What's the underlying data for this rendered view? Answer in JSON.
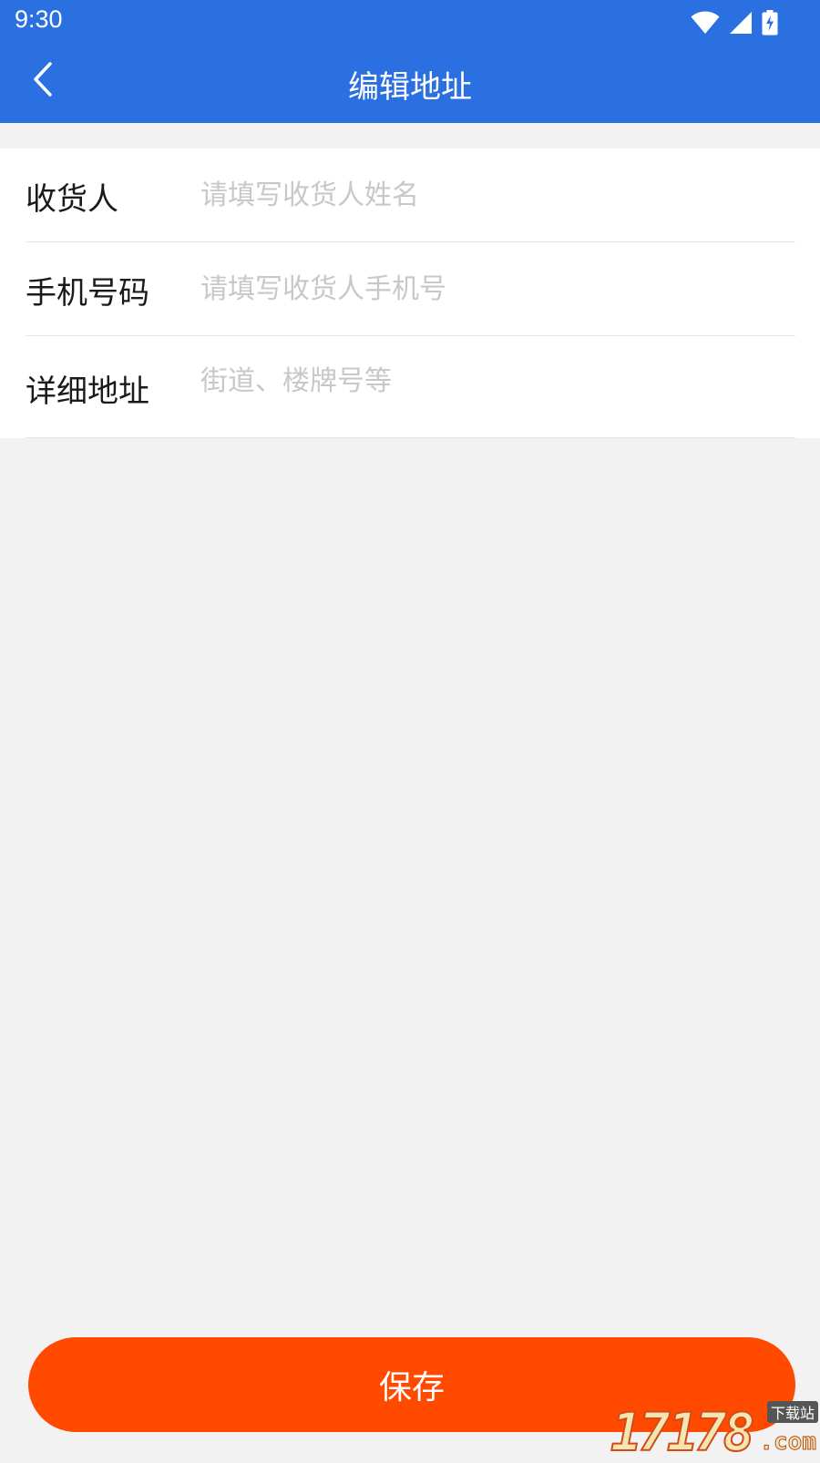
{
  "status_bar": {
    "time": "9:30",
    "icons": [
      "wifi-icon",
      "signal-icon",
      "battery-charging-icon"
    ]
  },
  "header": {
    "back_icon": "chevron-left-icon",
    "title": "编辑地址"
  },
  "form": {
    "rows": [
      {
        "label": "收货人",
        "value": "",
        "placeholder": "请填写收货人姓名"
      },
      {
        "label": "手机号码",
        "value": "",
        "placeholder": "请填写收货人手机号"
      },
      {
        "label": "详细地址",
        "value": "",
        "placeholder": "街道、楼牌号等"
      }
    ]
  },
  "footer": {
    "save_label": "保存"
  },
  "watermark": {
    "number": "17178",
    "domain": ".com",
    "tag": "下载站"
  },
  "colors": {
    "primary": "#2a70e0",
    "accent": "#ff4a00",
    "background": "#f2f2f2",
    "placeholder": "#c8c8c8"
  }
}
